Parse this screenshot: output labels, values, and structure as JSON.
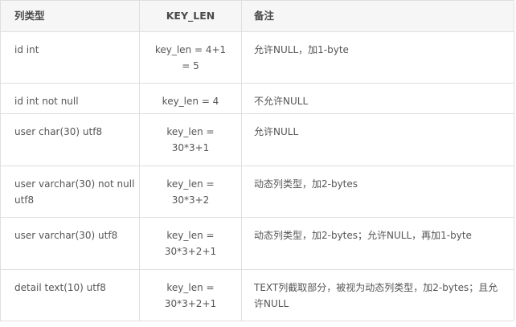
{
  "headers": {
    "type": "列类型",
    "key_len": "KEY_LEN",
    "note": "备注"
  },
  "rows": [
    {
      "type": "id int",
      "key_len": [
        "key_len = 4+1",
        "= 5"
      ],
      "note": "允许NULL，加1-byte"
    },
    {
      "type": "id int not null",
      "key_len": [
        "key_len = 4"
      ],
      "note": "不允许NULL"
    },
    {
      "type": "user char(30) utf8",
      "key_len": [
        "key_len =",
        "30*3+1"
      ],
      "note": "允许NULL"
    },
    {
      "type": "user varchar(30) not null utf8",
      "key_len": [
        "key_len =",
        "30*3+2"
      ],
      "note": "动态列类型，加2-bytes"
    },
    {
      "type": "user varchar(30) utf8",
      "key_len": [
        "key_len =",
        "30*3+2+1"
      ],
      "note": "动态列类型，加2-bytes；允许NULL，再加1-byte"
    },
    {
      "type": "detail text(10) utf8",
      "key_len": [
        "key_len =",
        "30*3+2+1"
      ],
      "note": "TEXT列截取部分，被视为动态列类型，加2-bytes；且允许NULL"
    }
  ]
}
